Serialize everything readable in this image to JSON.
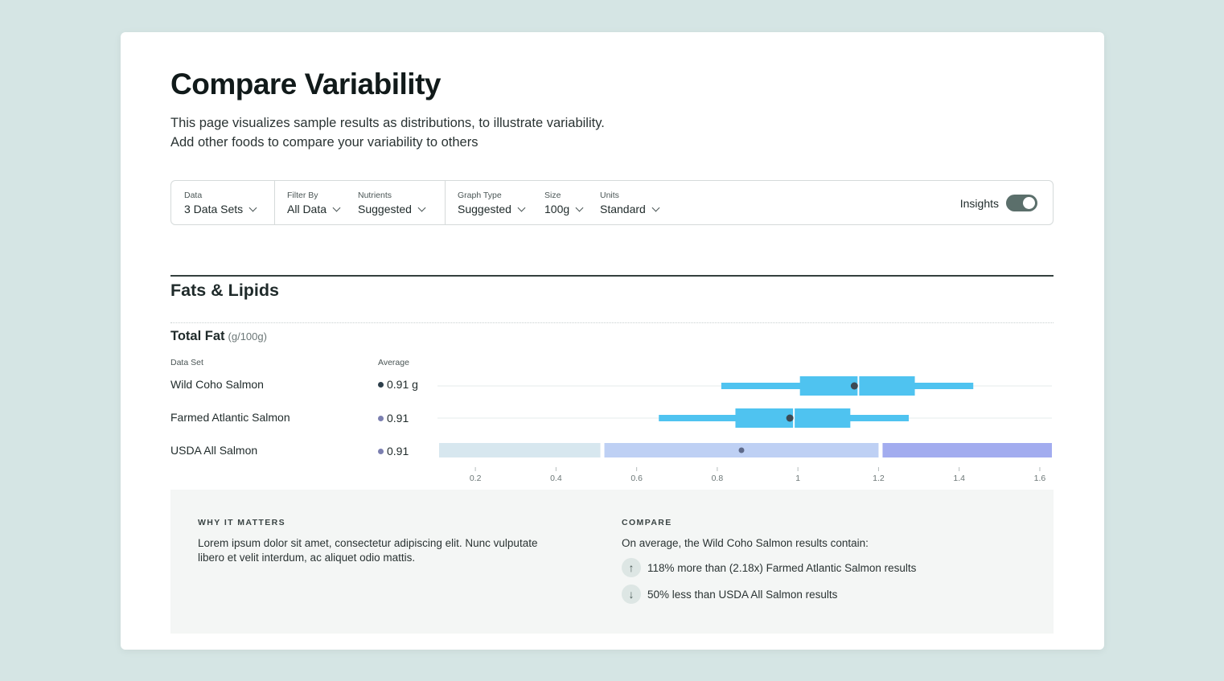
{
  "page": {
    "title": "Compare Variability",
    "description_line1": "This page visualizes sample results as distributions, to illustrate variability.",
    "description_line2": "Add other foods to compare your variability to others"
  },
  "toolbar": {
    "data": {
      "label": "Data",
      "value": "3 Data Sets"
    },
    "filter_by": {
      "label": "Filter By",
      "value": "All Data"
    },
    "nutrients": {
      "label": "Nutrients",
      "value": "Suggested"
    },
    "graph_type": {
      "label": "Graph Type",
      "value": "Suggested"
    },
    "size": {
      "label": "Size",
      "value": "100g"
    },
    "units": {
      "label": "Units",
      "value": "Standard"
    },
    "insights": {
      "label": "Insights",
      "enabled": true
    }
  },
  "section": {
    "title": "Fats & Lipids",
    "metric": {
      "name": "Total Fat",
      "unit": "(g/100g)"
    },
    "col_dataset": "Data Set",
    "col_average": "Average",
    "rows": [
      {
        "name": "Wild Coho Salmon",
        "average": "0.91 g",
        "dot_color": "#2c3e4a"
      },
      {
        "name": "Farmed Atlantic Salmon",
        "average": "0.91",
        "dot_color": "#7b7fb0"
      },
      {
        "name": "USDA All Salmon",
        "average": "0.91",
        "dot_color": "#7b7fb0"
      }
    ]
  },
  "chart_data": {
    "type": "boxplot",
    "x_ticks": [
      "0.2",
      "0.4",
      "0.6",
      "0.8",
      "1",
      "1.2",
      "1.4",
      "1.6"
    ],
    "xlim": [
      0.11,
      1.63
    ],
    "series": [
      {
        "name": "Wild Coho Salmon",
        "min": 0.81,
        "q1": 1.005,
        "median": 1.15,
        "q3": 1.29,
        "max": 1.435,
        "mean": 1.14,
        "color": "#4fc3f0"
      },
      {
        "name": "Farmed Atlantic Salmon",
        "min": 0.655,
        "q1": 0.845,
        "median": 0.99,
        "q3": 1.13,
        "max": 1.275,
        "mean": 0.98,
        "color": "#4fc3f0"
      },
      {
        "name": "USDA All Salmon",
        "bands": [
          {
            "from": 0.11,
            "to": 0.51,
            "color": "#d7e7ef"
          },
          {
            "from": 0.52,
            "to": 1.2,
            "color": "#bed0f4"
          },
          {
            "from": 1.21,
            "to": 1.63,
            "color": "#a2acef"
          }
        ],
        "mean": 0.86
      }
    ],
    "colors": {
      "box": "#4fc3f0",
      "mean_dot": "#3c4a54",
      "usda_dot": "#5e6a8a"
    }
  },
  "insights": {
    "why_title": "WHY IT MATTERS",
    "why_line1": "Lorem ipsum dolor sit amet, consectetur adipiscing elit. Nunc vulputate",
    "why_line2": "libero et velit interdum, ac aliquet odio mattis.",
    "compare_title": "COMPARE",
    "compare_intro": "On average, the Wild Coho Salmon results contain:",
    "compare_items": [
      {
        "icon": "arrow-up-icon",
        "glyph": "↑",
        "text": "118% more than (2.18x) Farmed Atlantic Salmon results"
      },
      {
        "icon": "arrow-down-icon",
        "glyph": "↓",
        "text": "50% less than USDA All Salmon results"
      }
    ]
  }
}
